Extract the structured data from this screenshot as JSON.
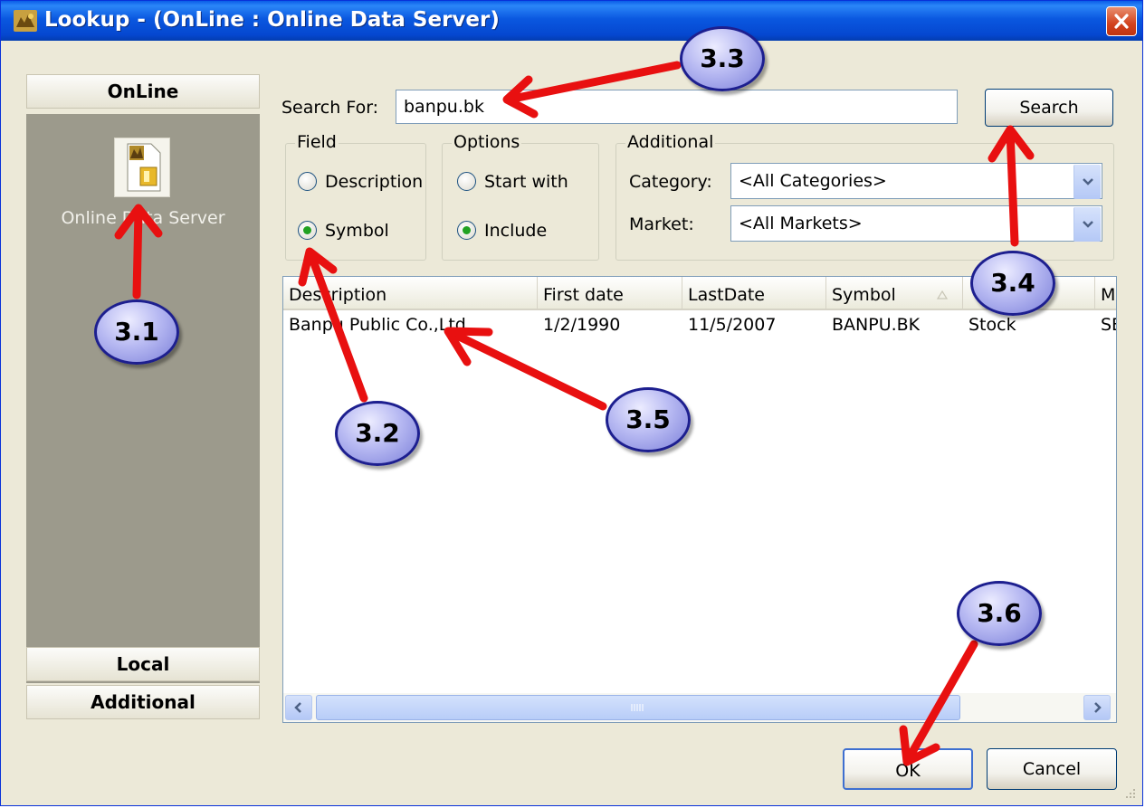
{
  "window": {
    "title": "Lookup - (OnLine : Online Data Server)"
  },
  "sidebar": {
    "online_header": "OnLine",
    "online_item_label": "Online Data Server",
    "local_header": "Local",
    "additional_header": "Additional"
  },
  "search": {
    "label": "Search For:",
    "value": "banpu.bk",
    "button_label": "Search"
  },
  "field_group": {
    "title": "Field",
    "options": [
      "Description",
      "Symbol"
    ],
    "selected": "Symbol"
  },
  "options_group": {
    "title": "Options",
    "options": [
      "Start with",
      "Include"
    ],
    "selected": "Include"
  },
  "additional_group": {
    "title": "Additional",
    "category_label": "Category:",
    "category_value": "<All Categories>",
    "market_label": "Market:",
    "market_value": "<All Markets>"
  },
  "results": {
    "columns": [
      "Description",
      "First date",
      "LastDate",
      "Symbol",
      "",
      "M"
    ],
    "rows": [
      [
        "Banpu Public Co.,Ltd.",
        "1/2/1990",
        "11/5/2007",
        "BANPU.BK",
        "Stock",
        "SE"
      ]
    ]
  },
  "footer": {
    "ok_label": "OK",
    "cancel_label": "Cancel"
  },
  "callouts": {
    "c31": "3.1",
    "c32": "3.2",
    "c33": "3.3",
    "c34": "3.4",
    "c35": "3.5",
    "c36": "3.6"
  },
  "colors": {
    "titlebar": "#0A58E0",
    "dialog_bg": "#ECE9D8",
    "sidebar_body": "#9C9A8C",
    "annotation_arrow": "#E81010",
    "callout_fill": "#B7B9F2",
    "radio_dot": "#21A121"
  }
}
